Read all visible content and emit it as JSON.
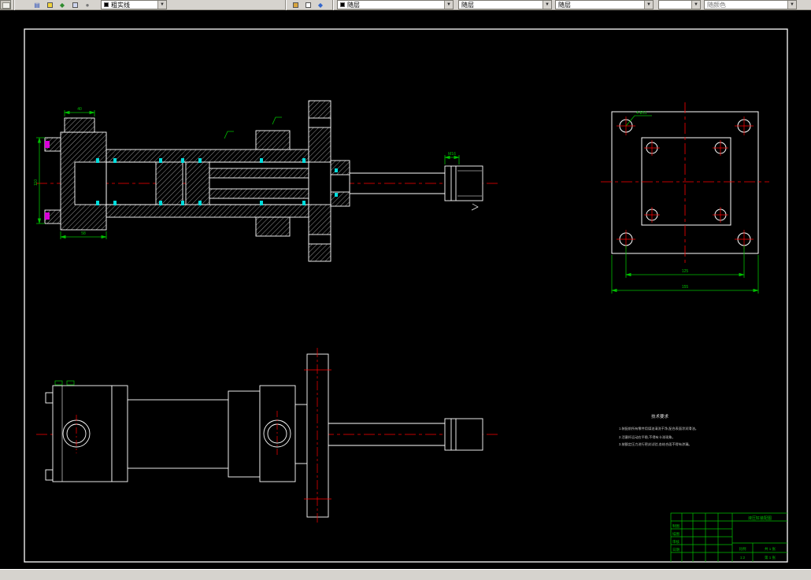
{
  "toolbar": {
    "layer_combo": "粗实线",
    "color_combo": "随层",
    "linetype_combo": "随层",
    "lineweight_combo": "随层",
    "plotstyle_combo": "随颜色",
    "arrow": "▼"
  },
  "drawing": {
    "section_view": {
      "dim_top": "40",
      "dim_left": "110",
      "dim_bottom": "58",
      "dim_rod_end": "M16"
    },
    "flange_view": {
      "leader": "4-Ø11",
      "dim_bolt_spacing": "125",
      "dim_overall": "155"
    },
    "notes": {
      "title": "技术要求",
      "line1": "1.装配前所有零件用煤油清洗干净,配合表面涂润滑油。",
      "line2": "2.活塞杆运动应平稳,不得有卡滞现象。",
      "line3": "3.按额定压力进行密封试验,各结合面不得有渗漏。"
    },
    "title_block": {
      "drawing_title": "液压缸装配图",
      "scale_label": "比例",
      "scale_value": "1:2",
      "sheets_label": "共 1 张",
      "sheet_no_label": "第 1 张",
      "row1": "制图",
      "row2": "描图",
      "row3": "审核",
      "row4": "日期"
    }
  }
}
